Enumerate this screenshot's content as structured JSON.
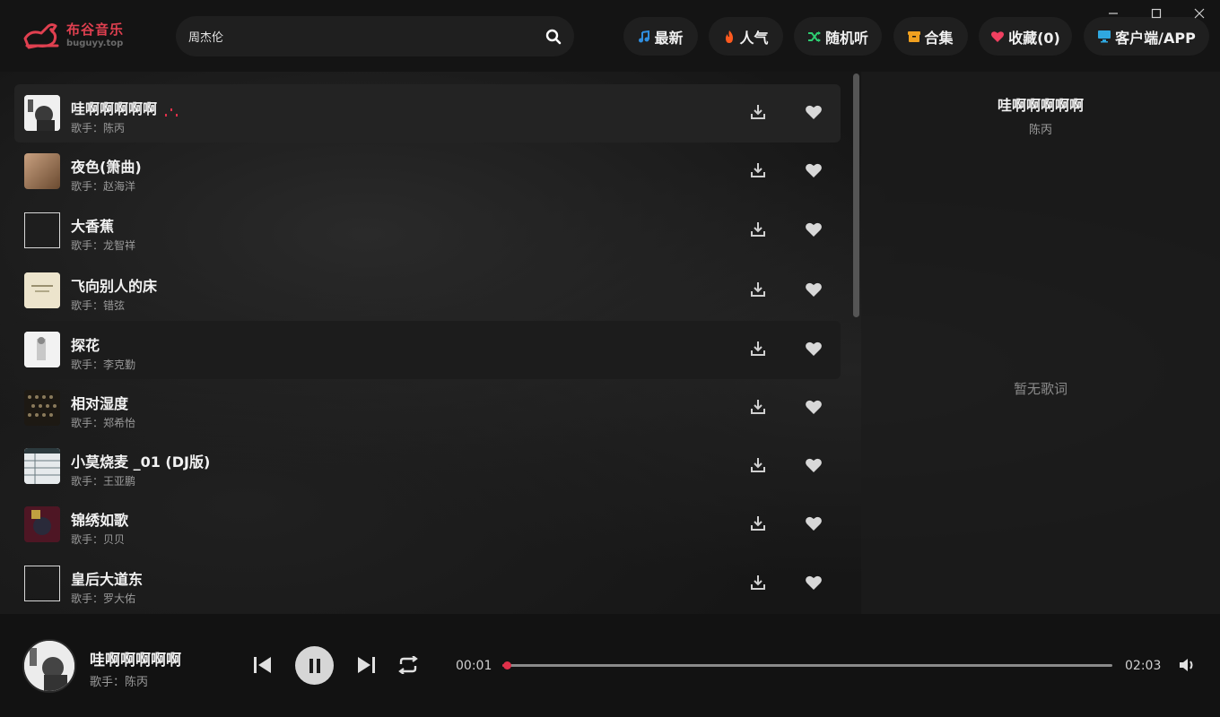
{
  "app": {
    "logo_title": "布谷音乐",
    "logo_domain": "buguyy.top",
    "brand_color": "#e04050"
  },
  "search": {
    "value": "周杰伦",
    "icon": "search-icon"
  },
  "nav": [
    {
      "label": "最新",
      "icon": "music-note-icon",
      "color": "#2f8ee0"
    },
    {
      "label": "人气",
      "icon": "fire-icon",
      "color": "#ff5a1f"
    },
    {
      "label": "随机听",
      "icon": "shuffle-icon",
      "color": "#2ecc71"
    },
    {
      "label": "合集",
      "icon": "box-icon",
      "color": "#f0a020"
    },
    {
      "label": "收藏(0)",
      "icon": "heart-icon",
      "color": "#f04060"
    },
    {
      "label": "客户端/APP",
      "icon": "desktop-icon",
      "color": "#2fa8e0"
    }
  ],
  "window_controls": [
    "minimize-icon",
    "maximize-icon",
    "close-icon"
  ],
  "songs": [
    {
      "title": "哇啊啊啊啊啊",
      "artist": "歌手：陈丙",
      "cover": "photo",
      "playing": true
    },
    {
      "title": "夜色(箫曲)",
      "artist": "歌手：赵海洋",
      "cover": "photo",
      "playing": false
    },
    {
      "title": "大香蕉",
      "artist": "歌手：龙智祥",
      "cover": "broken",
      "playing": false
    },
    {
      "title": "飞向别人的床",
      "artist": "歌手：错弦",
      "cover": "photo",
      "playing": false
    },
    {
      "title": "探花",
      "artist": "歌手：李克勤",
      "cover": "photo",
      "playing": false
    },
    {
      "title": "相对湿度",
      "artist": "歌手：郑希怡",
      "cover": "photo",
      "playing": false
    },
    {
      "title": "小莫烧麦 _01 (DJ版)",
      "artist": "歌手：王亚鹏",
      "cover": "photo",
      "playing": false
    },
    {
      "title": "锦绣如歌",
      "artist": "歌手：贝贝",
      "cover": "photo",
      "playing": false
    },
    {
      "title": "皇后大道东",
      "artist": "歌手：罗大佑",
      "cover": "broken",
      "playing": false
    }
  ],
  "lyrics": {
    "title": "哇啊啊啊啊啊",
    "artist": "陈丙",
    "empty_text": "暂无歌词"
  },
  "player": {
    "title": "哇啊啊啊啊啊",
    "artist": "歌手：陈丙",
    "current_time": "00:01",
    "total_time": "02:03",
    "progress": 0.008,
    "accent": "#e0304a"
  }
}
